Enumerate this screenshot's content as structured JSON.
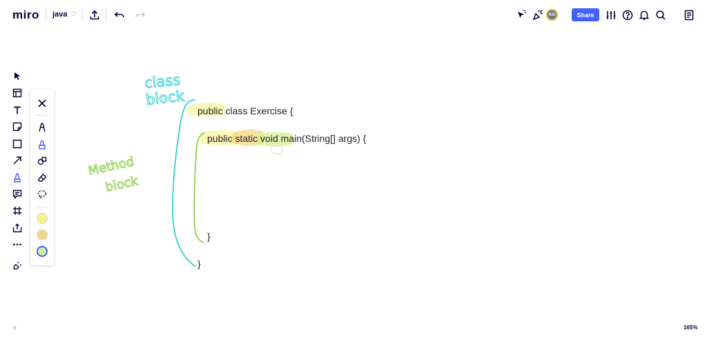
{
  "header": {
    "logo": "miro",
    "board_name": "java",
    "share_label": "Share",
    "avatar_initials": "KO"
  },
  "icons": {
    "star": "star-icon",
    "upload": "upload-icon",
    "undo": "undo-icon",
    "redo": "redo-icon",
    "cursor_share": "presenter-cursor-icon",
    "reactions": "reactions-icon",
    "settings": "sliders-icon",
    "help": "help-icon",
    "notifications": "bell-icon",
    "search": "search-icon",
    "notes": "notes-icon"
  },
  "left_toolbar": [
    {
      "name": "select-tool",
      "icon": "cursor-icon"
    },
    {
      "name": "templates-tool",
      "icon": "templates-icon"
    },
    {
      "name": "text-tool",
      "icon": "text-icon"
    },
    {
      "name": "sticky-note-tool",
      "icon": "sticky-note-icon"
    },
    {
      "name": "shape-tool",
      "icon": "square-icon"
    },
    {
      "name": "arrow-tool",
      "icon": "arrow-icon"
    },
    {
      "name": "pen-tool",
      "icon": "pen-icon",
      "active": true
    },
    {
      "name": "comment-tool",
      "icon": "comment-icon"
    },
    {
      "name": "frame-tool",
      "icon": "frame-icon"
    },
    {
      "name": "upload-tool",
      "icon": "upload-icon"
    },
    {
      "name": "more-tools",
      "icon": "more-icon"
    },
    {
      "name": "apps-tool",
      "icon": "plug-icon"
    }
  ],
  "pen_panel": {
    "tools": [
      "close-icon",
      "pen-icon",
      "highlighter-icon",
      "smart-drawing-icon",
      "eraser-icon",
      "lasso-icon"
    ],
    "colors": [
      "#f5f08a",
      "#f3d58a",
      "#d6ef9a"
    ],
    "selected_color_index": 2
  },
  "canvas": {
    "class_line_public": "public",
    "class_line_rest": " class Exercise {",
    "method_line_public": "public",
    "method_line_static": " static",
    "method_line_void": " void",
    "method_line_rest": " main(String[] args) {",
    "method_close": "}",
    "class_close": "}",
    "annotation_class_1": "class",
    "annotation_class_2": "block",
    "annotation_method_1": "Method",
    "annotation_method_2": "block",
    "colors": {
      "class_bracket": "#30cfd0",
      "method_bracket": "#8fd24a",
      "highlight_yellow": "#f7f07c",
      "highlight_orange": "#f2cf73",
      "highlight_green": "#d7ee8c"
    }
  },
  "footer": {
    "expand": "»",
    "zoom": "165%"
  }
}
